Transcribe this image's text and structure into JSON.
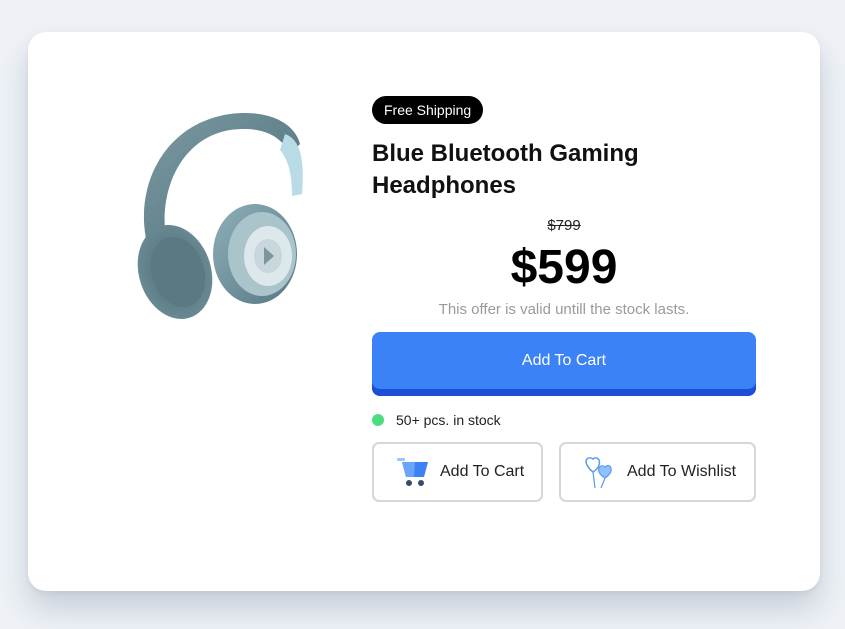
{
  "product": {
    "badge": "Free Shipping",
    "title": "Blue Bluetooth Gaming Headphones",
    "old_price": "$799",
    "price": "$599",
    "offer_note": "This offer is valid untill the stock lasts.",
    "stock_text": "50+ pcs. in stock",
    "image_icon": "headphones-image"
  },
  "actions": {
    "primary_label": "Add To Cart",
    "secondary_cart_label": "Add To Cart",
    "wishlist_label": "Add To Wishlist",
    "cart_icon": "cart-icon",
    "wishlist_icon": "heart-balloons-icon"
  },
  "colors": {
    "background": "#eef2f7",
    "card": "#ffffff",
    "primary": "#3b82f6",
    "primary_dark": "#1d4ed8",
    "stock_dot": "#4ade80",
    "badge_bg": "#000000"
  }
}
